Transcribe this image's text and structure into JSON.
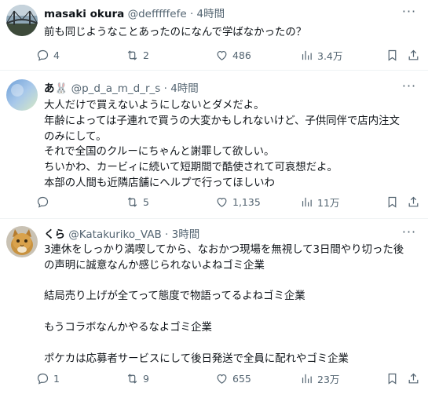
{
  "posts": [
    {
      "name": "masaki okura",
      "handle": "@defffffefe",
      "time": "· 4時間",
      "avatar_icon": "bridge-photo-avatar",
      "lines": [
        "前も同じようなことあったのになんで学ばなかったの？"
      ],
      "replies": "4",
      "reposts": "2",
      "likes": "486",
      "views": "3.4万"
    },
    {
      "name": "あ🐰",
      "handle": "@p_d_a_m_d_r_s",
      "time": "· 4時間",
      "avatar_icon": "sky-gradient-avatar",
      "lines": [
        "大人だけで買えないようにしないとダメだよ。",
        "年齢によっては子連れで買うの大変かもしれないけど、子供同伴で店内注文",
        "のみにして。",
        "それで全国のクルーにちゃんと謝罪して欲しい。",
        "ちいかわ、カービィに続いて短期間で酷使されて可哀想だよ。",
        "本部の人間も近隣店舗にヘルプで行ってほしいわ"
      ],
      "replies": "",
      "reposts": "5",
      "likes": "1,135",
      "views": "11万"
    },
    {
      "name": "くら",
      "handle": "@Katakuriko_VAB",
      "time": "· 3時間",
      "avatar_icon": "cat-photo-avatar",
      "lines": [
        "3連休をしっかり満喫してから、なおかつ現場を無視して3日間やり切った後",
        "の声明に誠意なんか感じられないよねゴミ企業",
        "",
        "結局売り上げが全てって態度で物語ってるよねゴミ企業",
        "",
        "もうコラボなんかやるなよゴミ企業",
        "",
        "ポケカは応募者サービスにして後日発送で全員に配れやゴミ企業"
      ],
      "replies": "1",
      "reposts": "9",
      "likes": "655",
      "views": "23万"
    }
  ],
  "icons": [
    "reply-icon",
    "repost-icon",
    "like-icon",
    "views-icon",
    "bookmark-icon",
    "share-icon",
    "more-icon"
  ],
  "colors": {
    "text": "#0f1419",
    "secondary": "#536471",
    "divider": "#eff3f4"
  }
}
